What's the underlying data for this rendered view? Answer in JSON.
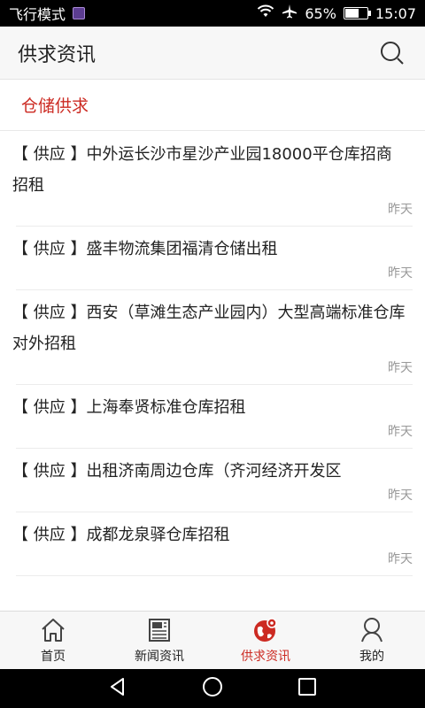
{
  "status_bar": {
    "mode_text": "飞行模式",
    "battery_text": "65%",
    "battery_level": 65,
    "time": "15:07"
  },
  "header": {
    "title": "供求资讯"
  },
  "section": {
    "label": "仓储供求"
  },
  "list": {
    "items": [
      {
        "text": "【 供应 】中外运长沙市星沙产业园18000平仓库招商招租",
        "date": "昨天"
      },
      {
        "text": "【 供应 】盛丰物流集团福清仓储出租",
        "date": "昨天"
      },
      {
        "text": "【 供应 】西安（草滩生态产业园内）大型高端标准仓库对外招租",
        "date": "昨天"
      },
      {
        "text": "【 供应 】上海奉贤标准仓库招租",
        "date": "昨天"
      },
      {
        "text": "【 供应 】出租济南周边仓库（齐河经济开发区",
        "date": "昨天"
      },
      {
        "text": "【 供应 】成都龙泉驿仓库招租",
        "date": "昨天"
      }
    ]
  },
  "bottom_nav": {
    "items": [
      {
        "label": "首页",
        "icon": "home-icon",
        "active": false
      },
      {
        "label": "新闻资讯",
        "icon": "newspaper-icon",
        "active": false
      },
      {
        "label": "供求资讯",
        "icon": "globe-pin-icon",
        "active": true
      },
      {
        "label": "我的",
        "icon": "user-icon",
        "active": false
      }
    ]
  },
  "colors": {
    "accent": "#cc2a22",
    "text": "#222222",
    "muted": "#999999"
  }
}
